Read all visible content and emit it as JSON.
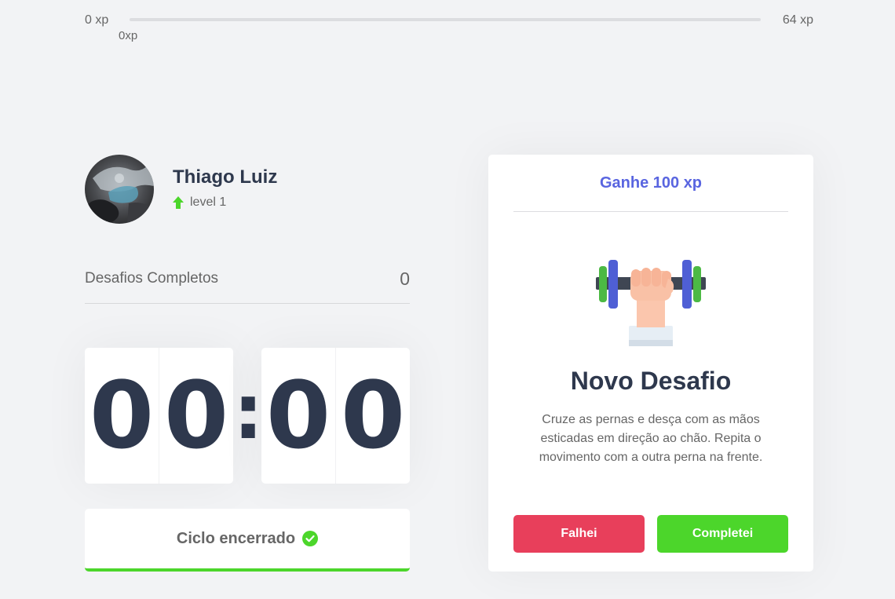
{
  "xp_bar": {
    "min_label": "0 xp",
    "max_label": "64 xp",
    "current_label": "0xp",
    "progress_fraction": 0,
    "fill_color": "#4cd62b"
  },
  "profile": {
    "name": "Thiago Luiz",
    "level_label": "level 1",
    "level_icon": "level-up-arrow-icon"
  },
  "completed_challenges": {
    "label": "Desafios Completos",
    "count": "0"
  },
  "countdown": {
    "minute_left": "0",
    "minute_right": "0",
    "separator": ":",
    "second_left": "0",
    "second_right": "0"
  },
  "cycle_button": {
    "label": "Ciclo encerrado",
    "icon": "check-circle-icon"
  },
  "challenge": {
    "reward": "Ganhe 100 xp",
    "icon": "dumbbell-icon",
    "title": "Novo Desafio",
    "description": "Cruze as pernas e desça com as mãos esticadas em direção ao chão. Repita o movimento com a outra perna na frente.",
    "fail_label": "Falhei",
    "complete_label": "Completei"
  },
  "colors": {
    "background": "#f2f3f5",
    "green": "#4cd62b",
    "red": "#e83f5b",
    "blue": "#5965e0",
    "title": "#2e384d",
    "text": "#666666"
  }
}
